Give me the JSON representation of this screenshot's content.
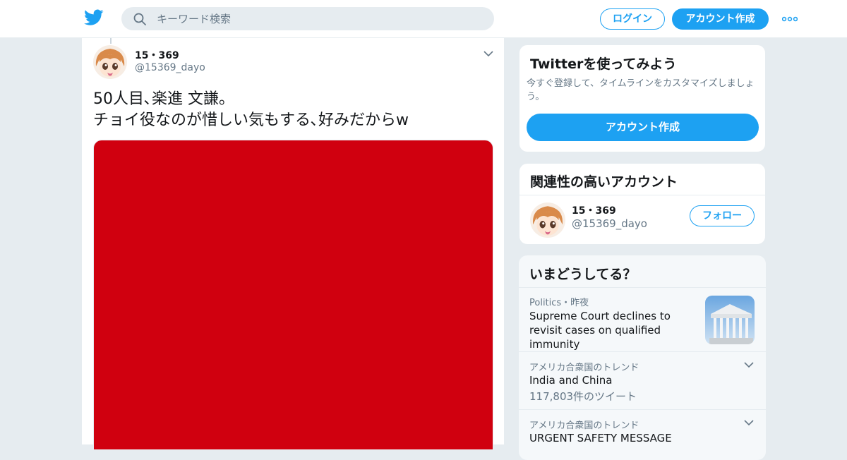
{
  "header": {
    "logo_icon": "twitter-bird-icon",
    "search_placeholder": "キーワード検索",
    "login_label": "ログイン",
    "signup_label": "アカウント作成",
    "more_icon": "more-dots-icon",
    "brand_color": "#1da1f2"
  },
  "tweet": {
    "author_name": "15・369",
    "author_handle": "@15369_dayo",
    "text": "50人目､楽進 文謙。\nチョイ役なのが惜しい気もする､好みだからw",
    "media_color": "#d0000f"
  },
  "sidebar": {
    "signup_card": {
      "title": "Twitterを使ってみよう",
      "description": "今すぐ登録して、タイムラインをカスタマイズしましょう。",
      "button_label": "アカウント作成"
    },
    "related": {
      "title": "関連性の高いアカウント",
      "name": "15・369",
      "handle": "@15369_dayo",
      "follow_label": "フォロー"
    },
    "trends": {
      "title": "いまどうしてる？",
      "items": [
        {
          "meta": "Politics・昨夜",
          "title": "Supreme Court declines to revisit cases on qualified immunity",
          "count": ""
        },
        {
          "meta": "アメリカ合衆国のトレンド",
          "title": "India and China",
          "count": "117,803件のツイート"
        },
        {
          "meta": "アメリカ合衆国のトレンド",
          "title": "URGENT SAFETY MESSAGE",
          "count": ""
        }
      ]
    }
  }
}
